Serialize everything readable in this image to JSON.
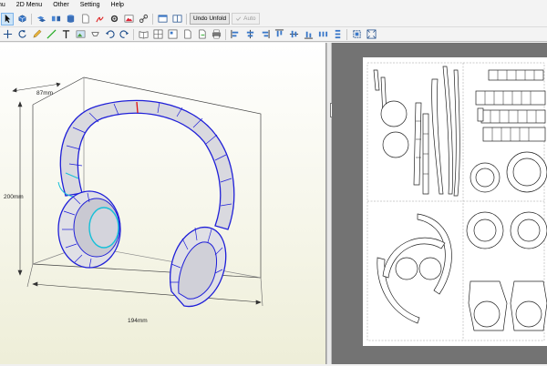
{
  "menu": {
    "items": [
      "nu",
      "2D Menu",
      "Other",
      "Setting",
      "Help"
    ]
  },
  "toolbar": {
    "undo_unfold_label": "Undo Unfold",
    "auto_label": "Auto"
  },
  "model": {
    "dim_depth": "87mm",
    "dim_height": "200mm",
    "dim_width": "194mm"
  },
  "colors": {
    "edge_blue": "#1f1fd8",
    "cut_cyan": "#16c0d8",
    "cut_red": "#e01010",
    "face_gray": "#d9d9df",
    "background_2d": "#737373"
  }
}
